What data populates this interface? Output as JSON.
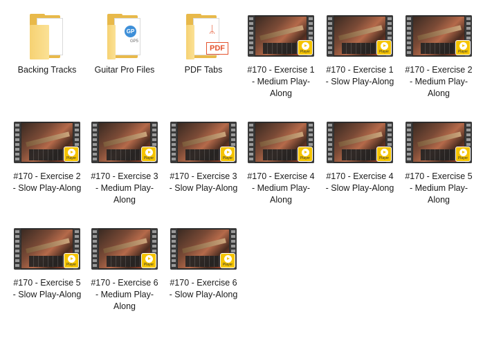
{
  "folders": [
    {
      "label": "Backing Tracks",
      "icon": "folder-icon"
    },
    {
      "label": "Guitar Pro Files",
      "icon": "folder-gp-icon",
      "badge": "GP",
      "sub": "GP5"
    },
    {
      "label": "PDF Tabs",
      "icon": "folder-pdf-icon",
      "badge": "PDF"
    }
  ],
  "videos": [
    {
      "label": "#170 - Exercise 1 - Medium Play-Along"
    },
    {
      "label": "#170 - Exercise 1 - Slow Play-Along"
    },
    {
      "label": "#170 - Exercise 2 - Medium Play-Along"
    },
    {
      "label": "#170 - Exercise 2 - Slow Play-Along"
    },
    {
      "label": "#170 - Exercise 3 - Medium Play-Along"
    },
    {
      "label": "#170 - Exercise 3 - Slow Play-Along"
    },
    {
      "label": "#170 - Exercise 4 - Medium Play-Along"
    },
    {
      "label": "#170 - Exercise 4 - Slow Play-Along"
    },
    {
      "label": "#170 - Exercise 5 - Medium Play-Along"
    },
    {
      "label": "#170 - Exercise 5 - Slow Play-Along"
    },
    {
      "label": "#170 - Exercise 6 - Medium Play-Along"
    },
    {
      "label": "#170 - Exercise 6 - Slow Play-Along"
    }
  ],
  "player_badge": "Player",
  "colors": {
    "folder": "#e8b94a",
    "badge": "#f5c400",
    "pdf": "#e4522c",
    "gp": "#3e8fd8"
  }
}
